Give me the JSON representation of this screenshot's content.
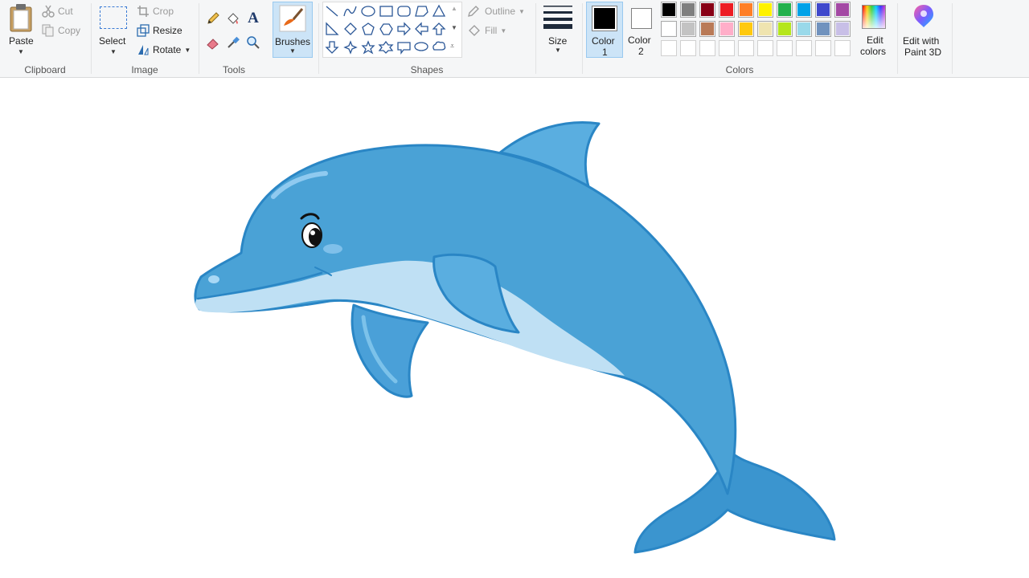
{
  "clipboard": {
    "paste_label": "Paste",
    "cut_label": "Cut",
    "copy_label": "Copy",
    "group_label": "Clipboard"
  },
  "image": {
    "select_label": "Select",
    "crop_label": "Crop",
    "resize_label": "Resize",
    "rotate_label": "Rotate",
    "group_label": "Image"
  },
  "tools": {
    "group_label": "Tools",
    "text_glyph": "A"
  },
  "brushes": {
    "label": "Brushes"
  },
  "shapes": {
    "group_label": "Shapes",
    "outline_label": "Outline",
    "fill_label": "Fill"
  },
  "size": {
    "label": "Size"
  },
  "colors": {
    "color1_label": "Color",
    "color1_num": "1",
    "color2_label": "Color",
    "color2_num": "2",
    "color1_value": "#000000",
    "color2_value": "#ffffff",
    "palette_row1": [
      "#000000",
      "#7f7f7f",
      "#880015",
      "#ed1c24",
      "#ff7f27",
      "#fff200",
      "#22b14c",
      "#00a2e8",
      "#3f48cc",
      "#a349a4"
    ],
    "palette_row2": [
      "#ffffff",
      "#c3c3c3",
      "#b97a57",
      "#ffaec9",
      "#ffc90e",
      "#efe4b0",
      "#b5e61d",
      "#99d9ea",
      "#7092be",
      "#c8bfe7"
    ],
    "edit_colors_label_1": "Edit",
    "edit_colors_label_2": "colors",
    "group_label": "Colors"
  },
  "paint3d": {
    "label_1": "Edit with",
    "label_2": "Paint 3D"
  }
}
